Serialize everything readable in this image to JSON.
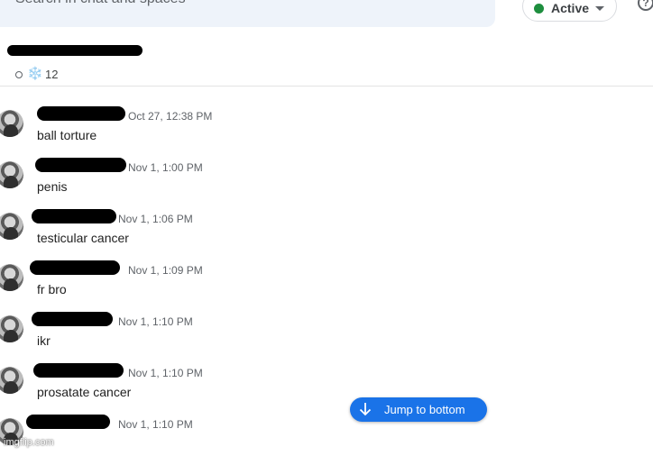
{
  "search": {
    "placeholder": "Search in chat and spaces"
  },
  "status": {
    "label": "Active",
    "color": "#1e8e3e"
  },
  "help": {
    "icon": "help-icon",
    "glyph": "?"
  },
  "space": {
    "member_count": "12",
    "snowflake_glyph": "❄️"
  },
  "messages": [
    {
      "time": "Oct 27, 12:38 PM",
      "text": "ball torture"
    },
    {
      "time": "Nov 1, 1:00 PM",
      "text": "penis"
    },
    {
      "time": "Nov 1, 1:06 PM",
      "text": "testicular cancer"
    },
    {
      "time": "Nov 1, 1:09 PM",
      "text": "fr bro"
    },
    {
      "time": "Nov 1, 1:10 PM",
      "text": "ikr"
    },
    {
      "time": "Nov 1, 1:10 PM",
      "text": "prosatate cancer"
    },
    {
      "time": "Nov 1, 1:10 PM",
      "text": ""
    }
  ],
  "jump_to_bottom": {
    "label": "Jump to bottom",
    "color": "#1a73e8"
  },
  "watermark": "imgflip.com"
}
